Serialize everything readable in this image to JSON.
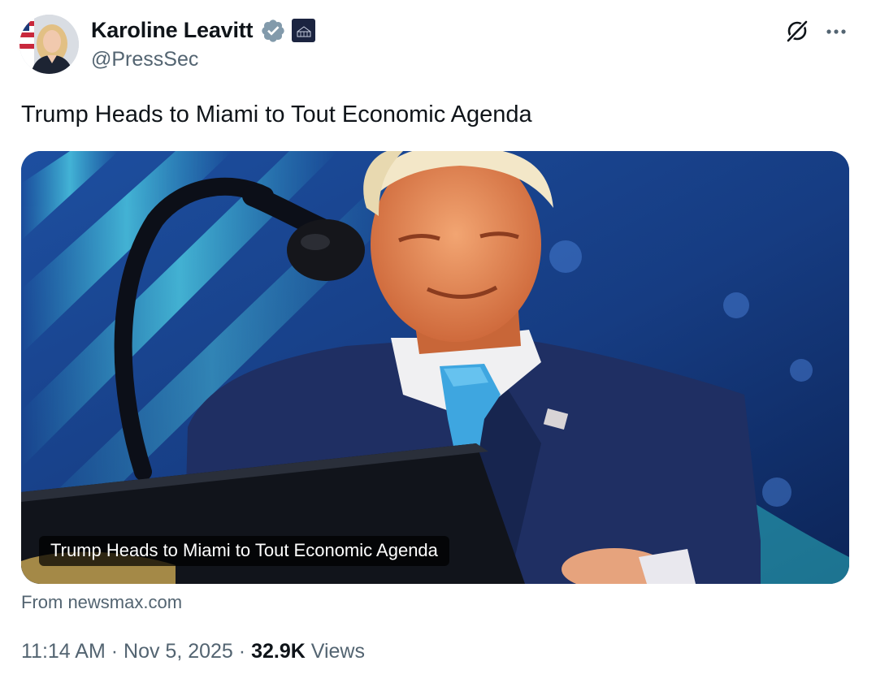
{
  "author": {
    "display_name": "Karoline Leavitt",
    "handle": "@PressSec",
    "verified_color": "#829aab",
    "affiliation_badge_text": "WHITE HOUSE"
  },
  "icons": {
    "avatar": "profile-photo",
    "verified": "verified-badge-icon",
    "affiliation": "white-house-badge-icon",
    "grok": "grok-icon",
    "more": "more-horizontal-icon"
  },
  "tweet": {
    "text": "Trump Heads to Miami to Tout Economic Agenda"
  },
  "card": {
    "caption": "Trump Heads to Miami to Tout Economic Agenda",
    "source": "From newsmax.com"
  },
  "meta": {
    "time": "11:14 AM",
    "separator": "·",
    "date": "Nov 5, 2025",
    "views_count": "32.9K",
    "views_label": "Views"
  },
  "colors": {
    "text_primary": "#0f1419",
    "text_secondary": "#536471",
    "card_background": "#1a3f7a"
  }
}
